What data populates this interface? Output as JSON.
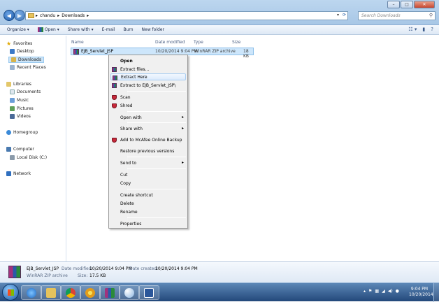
{
  "address": {
    "crumbs": [
      "chandu",
      "▸",
      "Downloads",
      "▸"
    ],
    "search_placeholder": "Search Downloads"
  },
  "toolbar": {
    "organize": "Organize ▾",
    "open": "Open ▾",
    "share": "Share with ▾",
    "email": "E-mail",
    "burn": "Burn",
    "new_folder": "New folder"
  },
  "nav": {
    "favorites": "Favorites",
    "desktop": "Desktop",
    "downloads": "Downloads",
    "recent": "Recent Places",
    "libraries": "Libraries",
    "documents": "Documents",
    "music": "Music",
    "pictures": "Pictures",
    "videos": "Videos",
    "homegroup": "Homegroup",
    "computer": "Computer",
    "local_disk": "Local Disk (C:)",
    "network": "Network"
  },
  "columns": {
    "name": "Name",
    "date": "Date modified",
    "type": "Type",
    "size": "Size"
  },
  "file": {
    "name": "EJB_Servlet_JSP",
    "date": "10/20/2014 9:04 PM",
    "type": "WinRAR ZIP archive",
    "size": "18 KB"
  },
  "menu": {
    "open": "Open",
    "extract_files": "Extract files...",
    "extract_here": "Extract Here",
    "extract_to": "Extract to EJB_Servlet_JSP\\",
    "scan": "Scan",
    "shred": "Shred",
    "open_with": "Open with",
    "share_with": "Share with",
    "mcafee": "Add to McAfee Online Backup",
    "restore": "Restore previous versions",
    "send_to": "Send to",
    "cut": "Cut",
    "copy": "Copy",
    "create_shortcut": "Create shortcut",
    "delete": "Delete",
    "rename": "Rename",
    "properties": "Properties"
  },
  "details": {
    "name": "EJB_Servlet_JSP",
    "type": "WinRAR ZIP archive",
    "date_modified_label": "Date modified:",
    "date_modified": "10/20/2014 9:04 PM",
    "date_created_label": "Date created:",
    "date_created": "10/20/2014 9:04 PM",
    "size_label": "Size:",
    "size": "17.5 KB"
  },
  "clock": {
    "time": "9:04 PM",
    "date": "10/20/2014"
  },
  "colors": {
    "selection": "#cde6fb",
    "taskbar": "#23487a"
  }
}
